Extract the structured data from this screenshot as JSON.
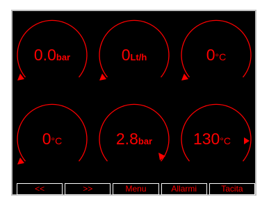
{
  "colors": {
    "accent": "#ff0000",
    "background": "#000000",
    "frame": "#bfbfbf",
    "button_border": "#ffffff"
  },
  "gauges": [
    {
      "value": "0.0",
      "unit": "bar",
      "pointer": "left-triangle-icon"
    },
    {
      "value": "0",
      "unit": "Lt/h",
      "pointer": "left-triangle-icon"
    },
    {
      "value": "0",
      "unit": "°C",
      "pointer": "left-triangle-icon"
    },
    {
      "value": "0",
      "unit": "°C",
      "pointer": "left-triangle-icon"
    },
    {
      "value": "2.8",
      "unit": "bar",
      "pointer": "right-triangle-icon"
    },
    {
      "value": "130",
      "unit": "°C",
      "pointer": "right-triangle-icon"
    }
  ],
  "buttons": [
    {
      "label": "<<"
    },
    {
      "label": ">>"
    },
    {
      "label": "Menu"
    },
    {
      "label": "Allarmi"
    },
    {
      "label": "Tacita"
    }
  ]
}
